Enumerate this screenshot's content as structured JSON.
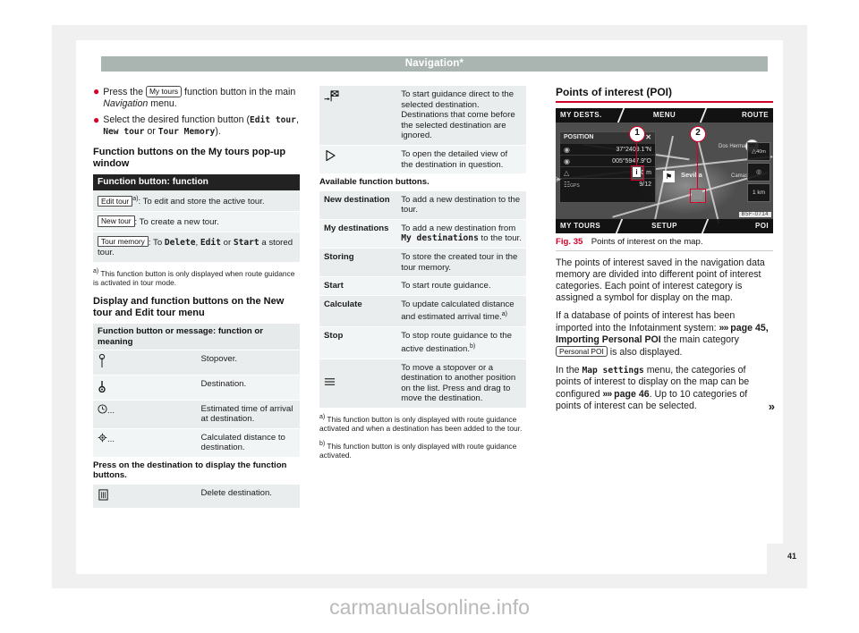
{
  "header": {
    "title": "Navigation*"
  },
  "page_number": "41",
  "watermark": "carmanualsonline.info",
  "left_column": {
    "bullets": [
      {
        "pre": "Press the ",
        "keycap": "My tours",
        "post": " function button in the main ",
        "italic": "Navigation",
        "tail": " menu."
      },
      {
        "pre": "Select the desired function button (",
        "mono1": "Edit tour",
        "sep1": ", ",
        "mono2": "New  tour",
        "sep2": " or ",
        "mono3": "Tour  Memory",
        "tail": ")."
      }
    ],
    "subheading_1_a": "Function buttons on the My  tours pop-up",
    "subheading_1_b": "window",
    "table_1": {
      "header": "Function button: function",
      "rows": [
        {
          "keycap": "Edit tour",
          "footnote": "a)",
          "text": ": To edit and store the active tour."
        },
        {
          "keycap": "New tour",
          "footnote": "",
          "text": ": To create a new tour."
        },
        {
          "keycap": "Tour memory",
          "footnote": "",
          "text": ": To Delete, Edit or Start a stored tour.",
          "mono_parts": [
            "Delete",
            "Edit",
            "Start"
          ]
        }
      ]
    },
    "footnote_a": "This function button is only displayed when route guidance is activated in tour mode.",
    "footnote_a_marker": "a)",
    "subheading_2_a": "Display and function buttons on the New",
    "subheading_2_b": "tour and Edit  tour menu",
    "table_2": {
      "header": "Function button or message: function or meaning",
      "rows": [
        {
          "icon": "stopover-pin-icon",
          "glyph": "♁",
          "text": "Stopover."
        },
        {
          "icon": "destination-pin-icon",
          "glyph": "♀",
          "text": "Destination."
        },
        {
          "icon": "clock-icon",
          "glyph": "◴",
          "suffix": "...",
          "text": "Estimated time of arrival at destination."
        },
        {
          "icon": "distance-icon",
          "glyph": "⊕",
          "suffix": "...",
          "text": "Calculated distance to destination."
        }
      ],
      "section_note": "Press on the destination to display the function buttons.",
      "rows_after": [
        {
          "icon": "trash-icon",
          "glyph": "Ὕ1",
          "text": "Delete destination."
        }
      ]
    }
  },
  "mid_column": {
    "table_top_rows": [
      {
        "icon": "flag-destination-icon",
        "text": "To start guidance direct to the selected destination. Destinations that come before the selected destination are ignored."
      },
      {
        "icon": "play-triangle-icon",
        "text": "To open the detailed view of the destination in question."
      }
    ],
    "section_note": "Available function buttons.",
    "rows": [
      {
        "key": "New destination",
        "text": "To add a new destination to the tour.",
        "key_mono": false
      },
      {
        "key": "My destinations",
        "text": "To add a new destination from My destinations to the tour.",
        "key_mono": false,
        "mono_inline": "My destinations"
      },
      {
        "key": "Storing",
        "text": "To store the created tour in the tour memory.",
        "key_mono": false
      },
      {
        "key": "Start",
        "text": "To start route guidance.",
        "key_mono": false
      },
      {
        "key": "Calculate",
        "text": "To update calculated distance and estimated arrival time.",
        "footnote": "a)",
        "key_mono": false
      },
      {
        "key": "Stop",
        "text": "To stop route guidance to the active destination.",
        "footnote": "b)",
        "key_mono": false
      },
      {
        "icon": "drag-handle-icon",
        "glyph": "≡",
        "text": "To move a stopover or a destination to another position on the list. Press and drag to move the destination."
      }
    ],
    "footnote_a_marker": "a)",
    "footnote_a": "This function button is only displayed with route guidance activated and when a destination has been added to the tour.",
    "footnote_b_marker": "b)",
    "footnote_b": "This function button is only displayed with route guidance activated."
  },
  "right_column": {
    "title": "Points of interest (POI)",
    "figure": {
      "caption_number": "Fig. 35",
      "caption_text": "Points of interest on the map.",
      "top_tabs": [
        "MY DESTS.",
        "MENU",
        "ROUTE"
      ],
      "bottom_tabs": [
        "MY TOURS",
        "SETUP",
        "POI"
      ],
      "panel_title": "POSITION",
      "panel_rows": [
        {
          "icon": "globe-icon",
          "value": "37°2409.1\"N"
        },
        {
          "icon": "globe-icon",
          "value": "005°5947.9\"O"
        },
        {
          "icon": "altitude-icon",
          "value": "40 m"
        },
        {
          "icon": "gps-icon",
          "label": "GPS",
          "value": "9/12"
        }
      ],
      "side_buttons": [
        "40m",
        "◎",
        "1 km"
      ],
      "callouts": [
        "1",
        "2"
      ],
      "map_labels": [
        "Sevilla",
        "Dos Hermanas",
        "Camas"
      ],
      "speed_limit": "50",
      "code_tag": "B5F-0714"
    },
    "paragraphs": [
      "The points of interest saved in the navigation data memory are divided into different point of interest categories. Each point of interest category is assigned a symbol for display on the map."
    ],
    "para2": {
      "pre": "If a database of points of interest has been imported into the Infotainment system: ",
      "arrows": "»»",
      "ref": "page 45, Importing Personal POI",
      "mid": " the main category ",
      "keycap": "Personal POI",
      "post": " is also displayed."
    },
    "para3": {
      "pre": "In the ",
      "mono": "Map  settings",
      "mid": " menu, the categories of points of interest to display on the map can be configured ",
      "arrows": "»»",
      "ref": "page 46",
      "post": ". Up to 10 categories of points of interest can be selected."
    },
    "continue_marker": "»"
  }
}
